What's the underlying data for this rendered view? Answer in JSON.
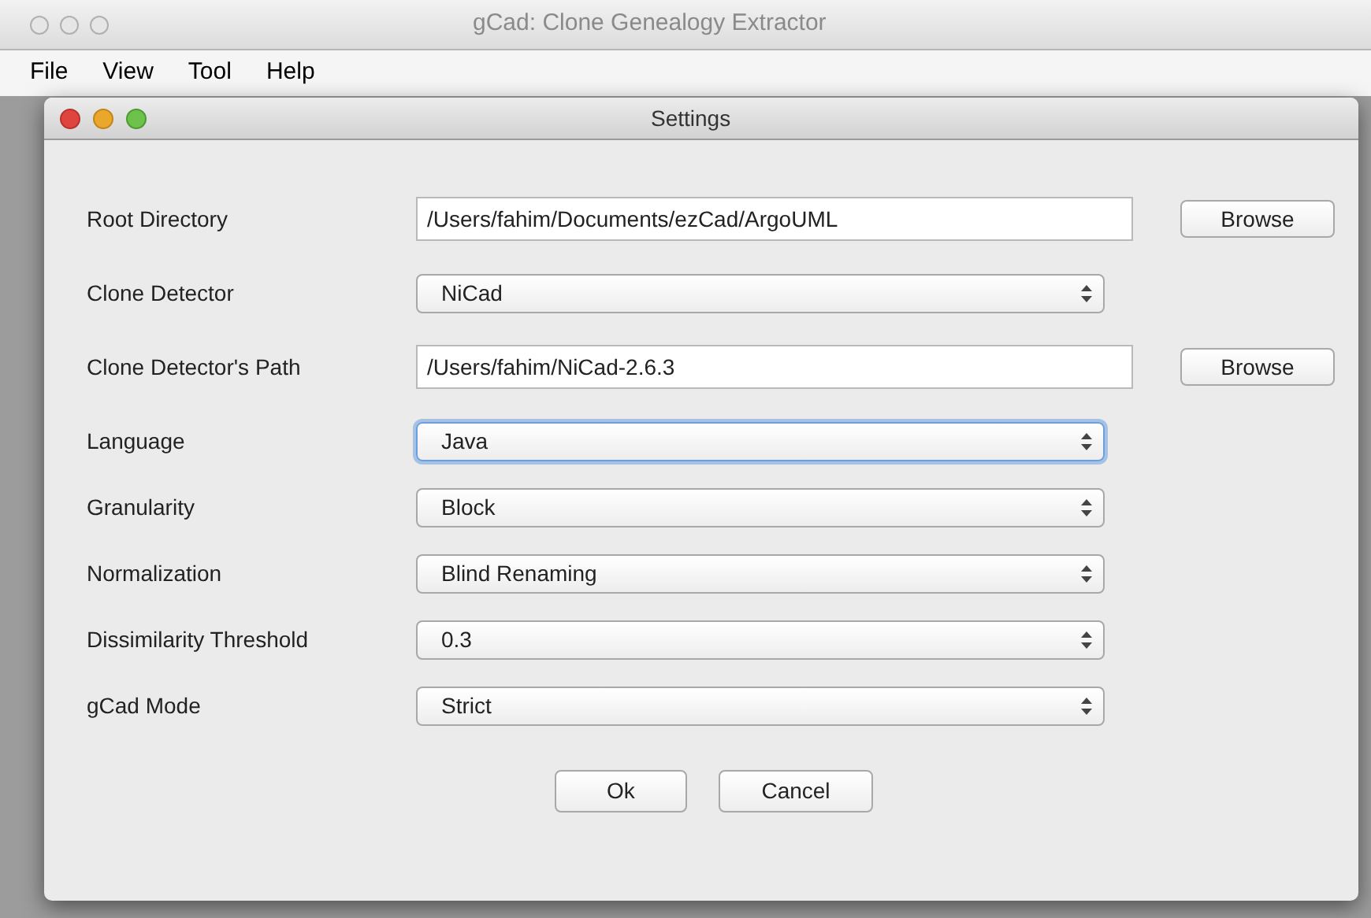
{
  "window": {
    "title": "gCad: Clone Genealogy Extractor"
  },
  "menu": [
    "File",
    "View",
    "Tool",
    "Help"
  ],
  "dialog": {
    "title": "Settings",
    "fields": [
      {
        "kind": "text",
        "label": "Root Directory",
        "value": "/Users/fahim/Documents/ezCad/ArgoUML",
        "button": "Browse"
      },
      {
        "kind": "select",
        "label": "Clone Detector",
        "value": "NiCad",
        "focused": false
      },
      {
        "kind": "text",
        "label": "Clone Detector's Path",
        "value": "/Users/fahim/NiCad-2.6.3",
        "button": "Browse"
      },
      {
        "kind": "select",
        "label": "Language",
        "value": "Java",
        "focused": true
      },
      {
        "kind": "select",
        "label": "Granularity",
        "value": "Block",
        "focused": false
      },
      {
        "kind": "select",
        "label": "Normalization",
        "value": "Blind Renaming",
        "focused": false
      },
      {
        "kind": "select",
        "label": "Dissimilarity Threshold",
        "value": "0.3",
        "focused": false
      },
      {
        "kind": "select",
        "label": "gCad Mode",
        "value": "Strict",
        "focused": false
      }
    ],
    "buttons": [
      "Ok",
      "Cancel"
    ]
  }
}
